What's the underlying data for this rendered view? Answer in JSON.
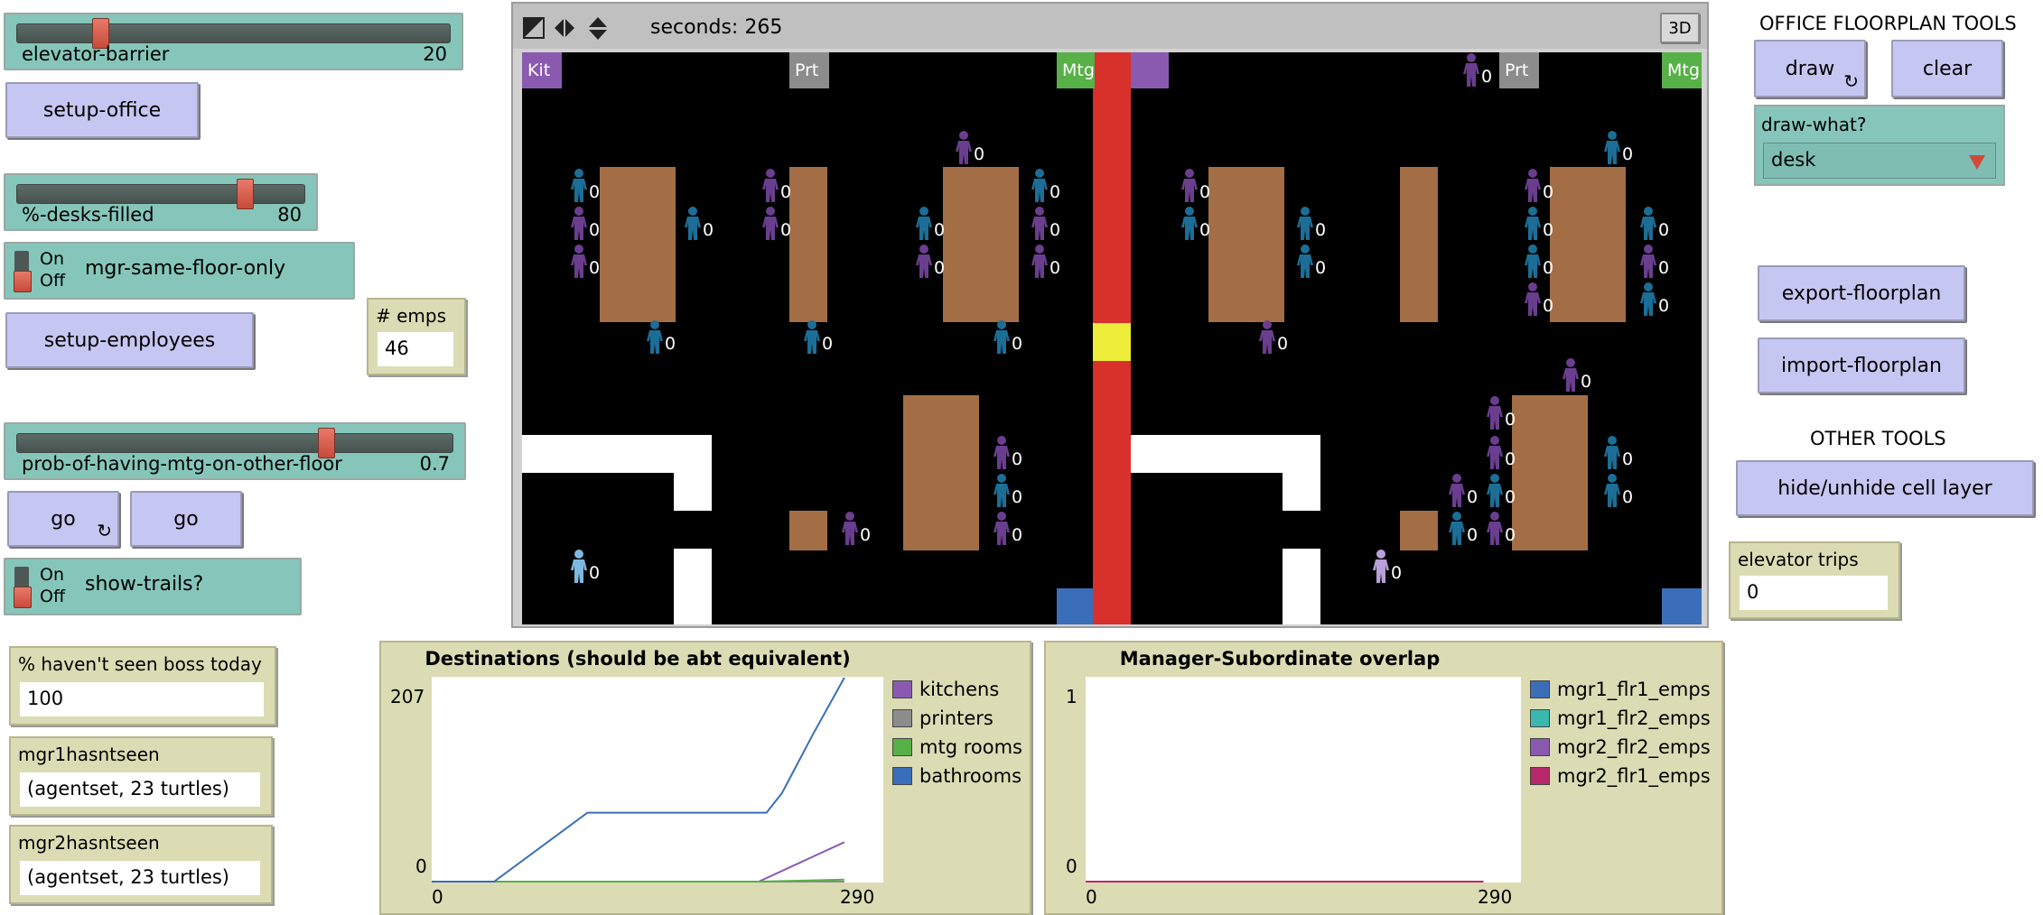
{
  "sliders": {
    "elevator_barrier": {
      "name": "elevator-barrier",
      "value": "20"
    },
    "pct_desks_filled": {
      "name": "%-desks-filled",
      "value": "80"
    },
    "prob_mtg": {
      "name": "prob-of-having-mtg-on-other-floor",
      "value": "0.7"
    }
  },
  "buttons": {
    "setup_office": "setup-office",
    "setup_employees": "setup-employees",
    "go_forever": "go",
    "go_once": "go",
    "draw": "draw",
    "clear": "clear",
    "export_floorplan": "export-floorplan",
    "import_floorplan": "import-floorplan",
    "hide_unhide": "hide/unhide cell layer"
  },
  "switches": {
    "mgr_same_floor": {
      "on": "On",
      "off": "Off",
      "label": "mgr-same-floor-only"
    },
    "show_trails": {
      "on": "On",
      "off": "Off",
      "label": "show-trails?"
    }
  },
  "monitors": {
    "emps": {
      "label": "# emps",
      "value": "46"
    },
    "havent_seen_boss": {
      "label": "% haven't seen boss today",
      "value": "100"
    },
    "mgr1": {
      "label": "mgr1hasntseen",
      "value": "(agentset, 23 turtles)"
    },
    "mgr2": {
      "label": "mgr2hasntseen",
      "value": "(agentset, 23 turtles)"
    },
    "elevator_trips": {
      "label": "elevator trips",
      "value": "0"
    }
  },
  "view": {
    "ticks_label": "seconds: 265",
    "three_d": "3D",
    "agent_label": "0",
    "room_labels": {
      "kit": "Kit",
      "prt": "Prt",
      "mtg": "Mtg"
    }
  },
  "tools": {
    "office_title": "OFFICE FLOORPLAN TOOLS",
    "other_title": "OTHER TOOLS",
    "chooser": {
      "label": "draw-what?",
      "value": "desk"
    }
  },
  "colors": {
    "elevator": "#d8302a",
    "elevator_car": "#eded3a",
    "desk": "#a36e45",
    "kitchen": "#8a5ab0",
    "printer": "#8c8c8c",
    "meeting": "#58b048",
    "bathroom": "#3a6eb8",
    "teal_person": "#1c6e96",
    "purple_person": "#6a3e8e"
  },
  "chart_data": [
    {
      "type": "line",
      "title": "Destinations (should be abt equivalent)",
      "xlim": [
        0,
        290
      ],
      "ylim": [
        0,
        207
      ],
      "x_ticks": [
        "0",
        "290"
      ],
      "y_ticks": [
        "0",
        "207"
      ],
      "legend": "right",
      "series": [
        {
          "name": "kitchens",
          "color": "#8a5ab0",
          "x": [
            0,
            210,
            265
          ],
          "y": [
            0,
            0,
            40
          ]
        },
        {
          "name": "printers",
          "color": "#8c8c8c",
          "x": [
            0,
            265
          ],
          "y": [
            0,
            0
          ]
        },
        {
          "name": "mtg rooms",
          "color": "#58b048",
          "x": [
            0,
            210,
            265
          ],
          "y": [
            0,
            0,
            2
          ]
        },
        {
          "name": "bathrooms",
          "color": "#3a6eb8",
          "x": [
            0,
            40,
            100,
            215,
            225,
            245,
            265
          ],
          "y": [
            0,
            0,
            70,
            70,
            90,
            150,
            207
          ]
        }
      ]
    },
    {
      "type": "line",
      "title": "Manager-Subordinate overlap",
      "xlim": [
        0,
        290
      ],
      "ylim": [
        0,
        1
      ],
      "x_ticks": [
        "0",
        "290"
      ],
      "y_ticks": [
        "0",
        "1"
      ],
      "legend": "right",
      "series": [
        {
          "name": "mgr1_flr1_emps",
          "color": "#3a6eb8",
          "x": [
            0,
            265
          ],
          "y": [
            0,
            0
          ]
        },
        {
          "name": "mgr1_flr2_emps",
          "color": "#3ab8b0",
          "x": [
            0,
            265
          ],
          "y": [
            0,
            0
          ]
        },
        {
          "name": "mgr2_flr2_emps",
          "color": "#8a5ab0",
          "x": [
            0,
            265
          ],
          "y": [
            0,
            0
          ]
        },
        {
          "name": "mgr2_flr1_emps",
          "color": "#b8286a",
          "x": [
            0,
            265
          ],
          "y": [
            0,
            0
          ]
        }
      ]
    }
  ]
}
